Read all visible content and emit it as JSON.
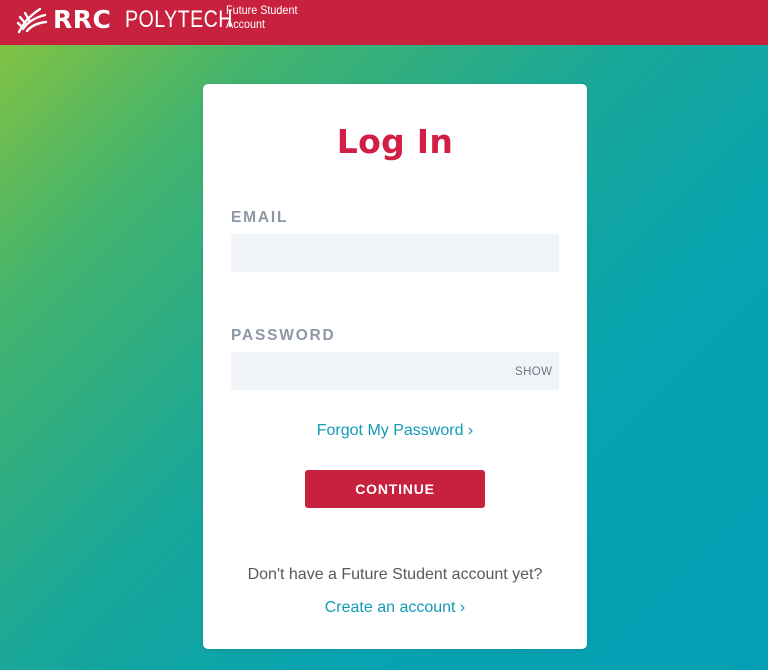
{
  "header": {
    "brand_strong": "RRC",
    "brand_light": "POLYTECH",
    "subtitle_line1": "Future Student",
    "subtitle_line2": "Account",
    "logo_icon": "rrc-feather-logo",
    "background_color": "#c8213e"
  },
  "login": {
    "title": "Log In",
    "email_label": "EMAIL",
    "email_value": "",
    "password_label": "PASSWORD",
    "password_value": "",
    "show_label": "SHOW",
    "forgot_link": "Forgot My Password ›",
    "continue_button": "CONTINUE",
    "no_account_text": "Don't have a Future Student account yet?",
    "create_link": "Create an account ›"
  },
  "colors": {
    "accent_red": "#c8213e",
    "title_red": "#d21f45",
    "link_teal": "#129bb6",
    "label_gray": "#8e98a4",
    "field_bg": "#f0f3f8"
  }
}
